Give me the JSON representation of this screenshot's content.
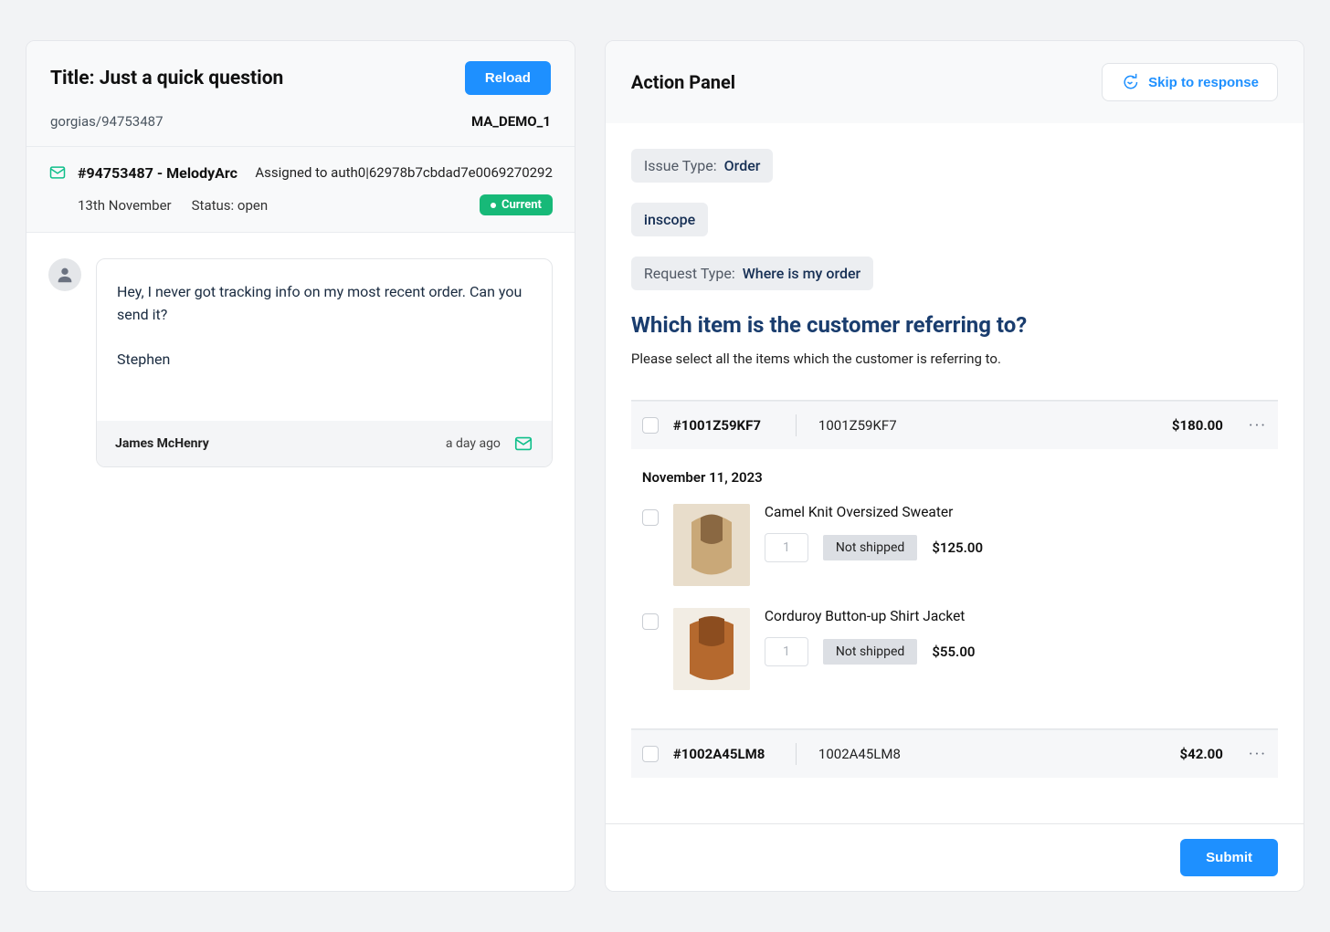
{
  "left": {
    "title": "Title: Just a quick question",
    "reload_label": "Reload",
    "source": "gorgias/94753487",
    "demo": "MA_DEMO_1",
    "ticket_id": "#94753487 - MelodyArc",
    "assigned": "Assigned to auth0|62978b7cbdad7e0069270292",
    "date": "13th November",
    "status": "Status: open",
    "current_badge": "Current",
    "message": {
      "body": "Hey, I never got tracking info on my most recent order.  Can you send it?\n\nStephen",
      "sender": "James McHenry",
      "time": "a day ago"
    }
  },
  "right": {
    "header": "Action Panel",
    "skip_label": "Skip to response",
    "tags": {
      "issue_label": "Issue Type:",
      "issue_value": "Order",
      "scope": "inscope",
      "request_label": "Request Type:",
      "request_value": "Where is my order"
    },
    "question": "Which item is the customer referring to?",
    "subtext": "Please select all the items which the customer is referring to.",
    "orders": [
      {
        "number": "#1001Z59KF7",
        "ref": "1001Z59KF7",
        "total": "$180.00",
        "date": "November 11, 2023",
        "items": [
          {
            "title": "Camel Knit Oversized Sweater",
            "qty": "1",
            "status": "Not shipped",
            "price": "$125.00"
          },
          {
            "title": "Corduroy Button-up Shirt Jacket",
            "qty": "1",
            "status": "Not shipped",
            "price": "$55.00"
          }
        ]
      },
      {
        "number": "#1002A45LM8",
        "ref": "1002A45LM8",
        "total": "$42.00",
        "items": []
      }
    ],
    "submit_label": "Submit"
  }
}
